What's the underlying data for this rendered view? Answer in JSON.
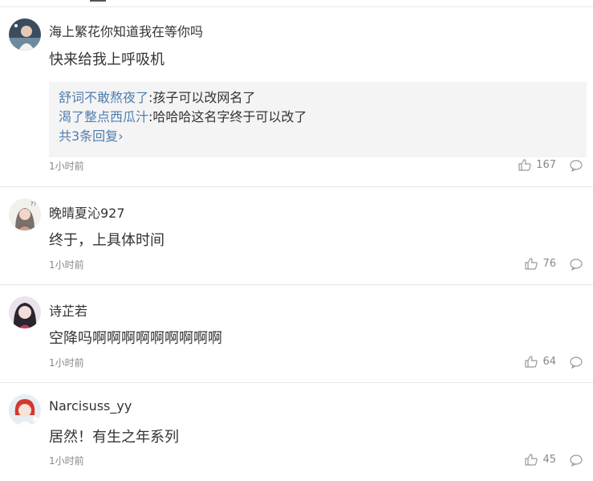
{
  "comments": [
    {
      "user": "海上繁花你知道我在等你吗",
      "text": "快来给我上呼吸机",
      "time": "1小时前",
      "likes": "167",
      "avatar_icon": "user-avatar",
      "replies": [
        {
          "user": "舒词不敢熬夜了",
          "sep": ":",
          "text": "孩子可以改网名了"
        },
        {
          "user": "渴了整点西瓜汁",
          "sep": ":",
          "text": "哈哈哈这名字终于可以改了"
        }
      ],
      "more_replies": "共3条回复",
      "more_chevron": "›"
    },
    {
      "user": "晚晴夏沁927",
      "text": "终于，上具体时间",
      "time": "1小时前",
      "likes": "76",
      "avatar_icon": "user-avatar"
    },
    {
      "user": "诗芷若",
      "text": "空降吗啊啊啊啊啊啊啊啊啊",
      "time": "1小时前",
      "likes": "64",
      "avatar_icon": "user-avatar"
    },
    {
      "user": "Narcisuss_yy",
      "text": "居然！有生之年系列",
      "time": "1小时前",
      "likes": "45",
      "avatar_icon": "user-avatar"
    }
  ],
  "icons": {
    "like": "thumbs-up-icon",
    "reply": "speech-bubble-icon"
  },
  "colors": {
    "link": "#507daf",
    "meta": "#888888",
    "reply_bg": "#f4f4f4",
    "divider": "#e6e6e6"
  }
}
